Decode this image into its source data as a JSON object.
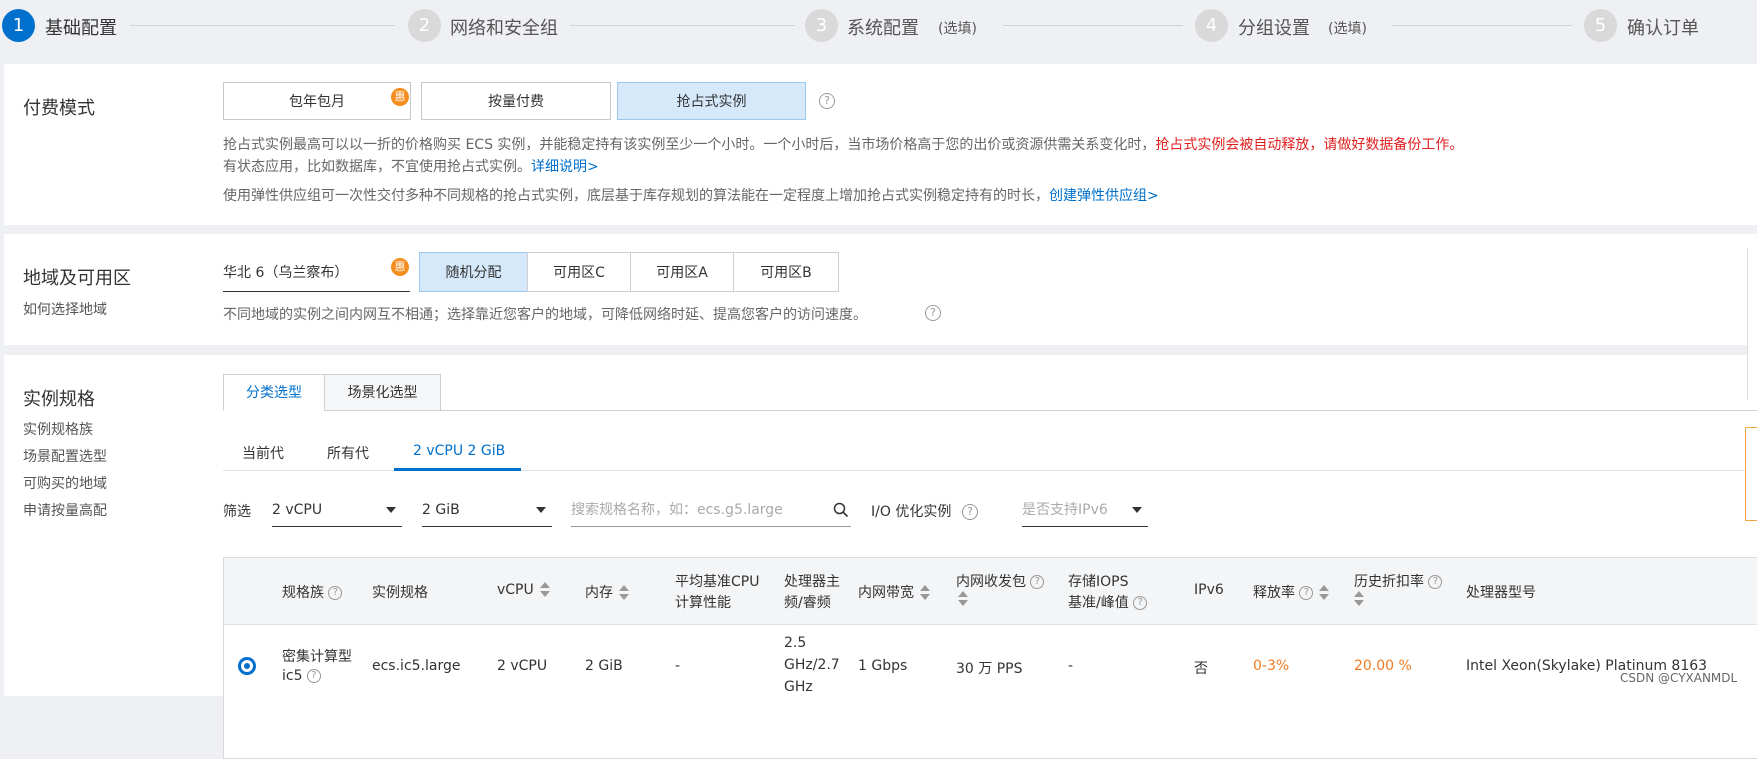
{
  "stepper": {
    "steps": [
      {
        "num": "1",
        "label": "基础配置",
        "optional": ""
      },
      {
        "num": "2",
        "label": "网络和安全组",
        "optional": ""
      },
      {
        "num": "3",
        "label": "系统配置",
        "optional": "(选填)"
      },
      {
        "num": "4",
        "label": "分组设置",
        "optional": "(选填)"
      },
      {
        "num": "5",
        "label": "确认订单",
        "optional": ""
      }
    ]
  },
  "payment": {
    "title": "付费模式",
    "options": [
      "包年包月",
      "按量付费",
      "抢占式实例"
    ],
    "badge": "惠",
    "desc_line1_a": "抢占式实例最高可以以一折的价格购买 ECS 实例，并能稳定持有该实例至少一个小时。一个小时后，当市场价格高于您的出价或资源供需关系变化时，",
    "desc_line1_red": "抢占式实例会被自动释放，请做好数据备份工作。",
    "desc_line2_a": "有状态应用，比如数据库，不宜使用抢占式实例。",
    "desc_line2_link": "详细说明>",
    "desc_line3_a": "使用弹性供应组可一次性交付多种不同规格的抢占式实例，底层基于库存规划的算法能在一定程度上增加抢占式实例稳定持有的时长，",
    "desc_line3_link": "创建弹性供应组>"
  },
  "region": {
    "title": "地域及可用区",
    "help_link": "如何选择地域",
    "selected_region": "华北 6（乌兰察布）",
    "badge": "惠",
    "zones": [
      "随机分配",
      "可用区C",
      "可用区A",
      "可用区B"
    ],
    "desc": "不同地域的实例之间内网互不相通；选择靠近您客户的地域，可降低网络时延、提高您客户的访问速度。"
  },
  "spec": {
    "title": "实例规格",
    "side_links": [
      "实例规格族",
      "场景配置选型",
      "可购买的地域",
      "申请按量高配"
    ],
    "tabs": [
      "分类选型",
      "场景化选型"
    ],
    "subtabs": [
      "当前代",
      "所有代",
      "2 vCPU 2 GiB"
    ],
    "filter": {
      "label": "筛选",
      "vcpu": "2 vCPU",
      "mem": "2 GiB",
      "search_placeholder": "搜索规格名称，如：ecs.g5.large",
      "io_label": "I/O 优化实例",
      "ipv6_placeholder": "是否支持IPv6"
    },
    "columns": {
      "family": "规格族",
      "spec": "实例规格",
      "vcpu": "vCPU",
      "mem": "内存",
      "cpu_perf_1": "平均基准CPU",
      "cpu_perf_2": "计算性能",
      "freq_1": "处理器主",
      "freq_2": "频/睿频",
      "bandwidth": "内网带宽",
      "pps": "内网收发包",
      "iops_1": "存储IOPS",
      "iops_2": "基准/峰值",
      "ipv6": "IPv6",
      "release": "释放率",
      "discount": "历史折扣率",
      "cpu_model": "处理器型号"
    },
    "row": {
      "family_1": "密集计算型",
      "family_2": "ic5",
      "spec": "ecs.ic5.large",
      "vcpu": "2 vCPU",
      "mem": "2 GiB",
      "cpu_perf": "-",
      "freq_1": "2.5",
      "freq_2": "GHz/2.7",
      "freq_3": "GHz",
      "bandwidth": "1 Gbps",
      "pps": "30 万 PPS",
      "iops": "-",
      "ipv6": "否",
      "release": "0-3%",
      "discount": "20.00 %",
      "cpu_model": "Intel Xeon(Skylake) Platinum 8163"
    }
  },
  "watermark": "CSDN @CYXANMDL",
  "colors": {
    "primary": "#0070cc",
    "selected_bg": "#d6e9fb",
    "badge": "#f58e1f",
    "danger": "#e02020",
    "warning": "#f27b21"
  }
}
